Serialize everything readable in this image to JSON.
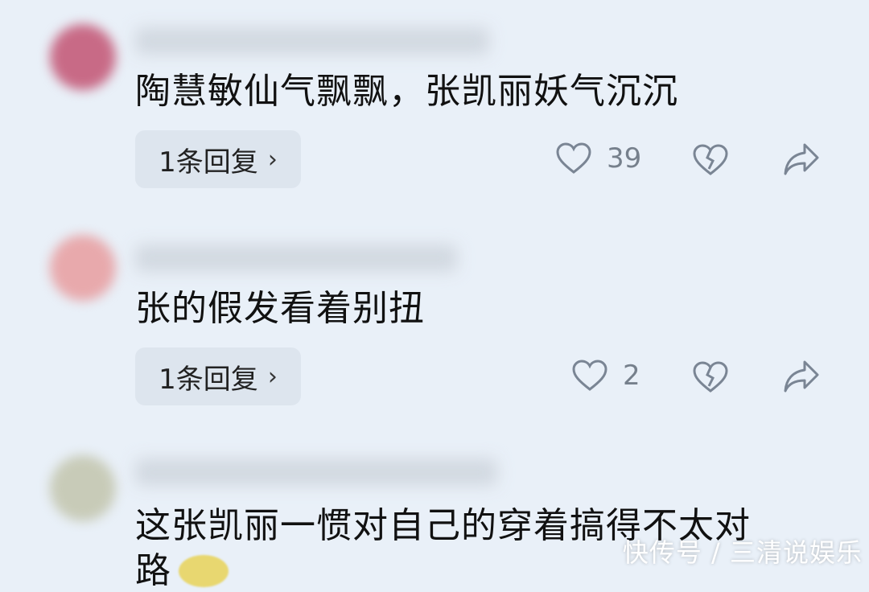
{
  "comments": [
    {
      "content": "陶慧敏仙气飘飘，张凯丽妖气沉沉",
      "reply": "1条回复",
      "likes": "39"
    },
    {
      "content": "张的假发看着别扭",
      "reply": "1条回复",
      "likes": "2"
    },
    {
      "content": "这张凯丽一惯对自己的穿着搞得不太对",
      "content_line2": "路"
    }
  ],
  "icons": {
    "like": "heart-icon",
    "dislike": "broken-heart-icon",
    "share": "share-icon",
    "chevron": "chevron-right-icon"
  },
  "reply_chevron": "›",
  "watermark": "快传号 / 三清说娱乐",
  "colors": {
    "background": "#e9f0f8",
    "reply_bg": "#dde5ee",
    "icon": "#7a8594"
  }
}
